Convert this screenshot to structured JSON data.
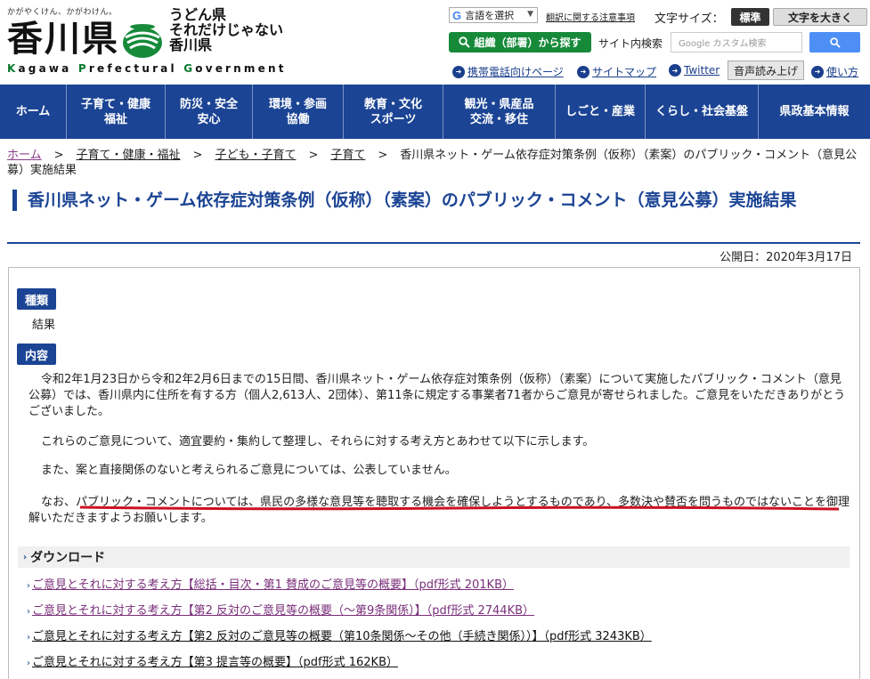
{
  "header": {
    "tagline": "かがやくけん、かがわけん。",
    "logo_kanji": "香川県",
    "logo_en": [
      "K",
      "agawa ",
      "P",
      "refectural ",
      "G",
      "overnment"
    ],
    "udon_lines": [
      "うどん県",
      "それだけじゃない",
      "香川県"
    ],
    "lang_select": "言語を選択",
    "translation_note": "翻訳に関する注意事項",
    "font_size_label": "文字サイズ：",
    "font_std": "標準",
    "font_big": "文字を大きく",
    "org_search": "組織（部署）から探す",
    "site_search_label": "サイト内検索",
    "search_placeholder": "Google カスタム検索",
    "util_links": [
      "携帯電話向けページ",
      "サイトマップ",
      "Twitter"
    ],
    "voice": "音声読み上げ",
    "help": "使い方"
  },
  "nav": [
    {
      "line1": "ホーム",
      "line2": ""
    },
    {
      "line1": "子育て・健康",
      "line2": "福祉"
    },
    {
      "line1": "防災・安全",
      "line2": "安心"
    },
    {
      "line1": "環境・参画",
      "line2": "協働"
    },
    {
      "line1": "教育・文化",
      "line2": "スポーツ"
    },
    {
      "line1": "観光・県産品",
      "line2": "交流・移住"
    },
    {
      "line1": "しごと・産業",
      "line2": ""
    },
    {
      "line1": "くらし・社会基盤",
      "line2": ""
    },
    {
      "line1": "県政基本情報",
      "line2": ""
    }
  ],
  "breadcrumb": {
    "items": [
      "ホーム",
      "子育て・健康・福祉",
      "子ども・子育て",
      "子育て"
    ],
    "current": "香川県ネット・ゲーム依存症対策条例（仮称）（素案）のパブリック・コメント（意見公募）実施結果",
    "sep": ">"
  },
  "page_title": "香川県ネット・ゲーム依存症対策条例（仮称）（素案）のパブリック・コメント（意見公募）実施結果",
  "published": "公開日：2020年3月17日",
  "content": {
    "type_label": "種類",
    "type_value": "結果",
    "content_label": "内容",
    "para1": "令和2年1月23日から令和2年2月6日までの15日間、香川県ネット・ゲーム依存症対策条例（仮称）（素案）について実施したパブリック・コメント（意見公募）では、香川県内に住所を有する方（個人2,613人、2団体）、第11条に規定する事業者71者からご意見が寄せられました。ご意見をいただきありがとうございました。",
    "para2": "これらのご意見について、適宜要約・集約して整理し、それらに対する考え方とあわせて以下に示します。",
    "para3": "また、案と直接関係のないと考えられるご意見については、公表していません。",
    "para4": "なお、パブリック・コメントについては、県民の多様な意見等を聴取する機会を確保しようとするものであり、多数決や賛否を問うものではないことを御理解いただきますようお願いします。"
  },
  "download": {
    "heading": "ダウンロード",
    "links": [
      "ご意見とそれに対する考え方【総括・目次・第1 賛成のご意見等の概要】（pdf形式 201KB）",
      "ご意見とそれに対する考え方【第2 反対のご意見等の概要（～第9条関係）】（pdf形式 2744KB）",
      "ご意見とそれに対する考え方【第2 反対のご意見等の概要（第10条関係～その他（手続き関係））】（pdf形式 3243KB）",
      "ご意見とそれに対する考え方【第3 提言等の概要】（pdf形式 162KB）"
    ]
  },
  "colors": {
    "nav_bg": "#1b4494",
    "brand_green": "#178a3a",
    "visited_link": "#7a2f7a",
    "annotation_red": "#cc1122"
  }
}
